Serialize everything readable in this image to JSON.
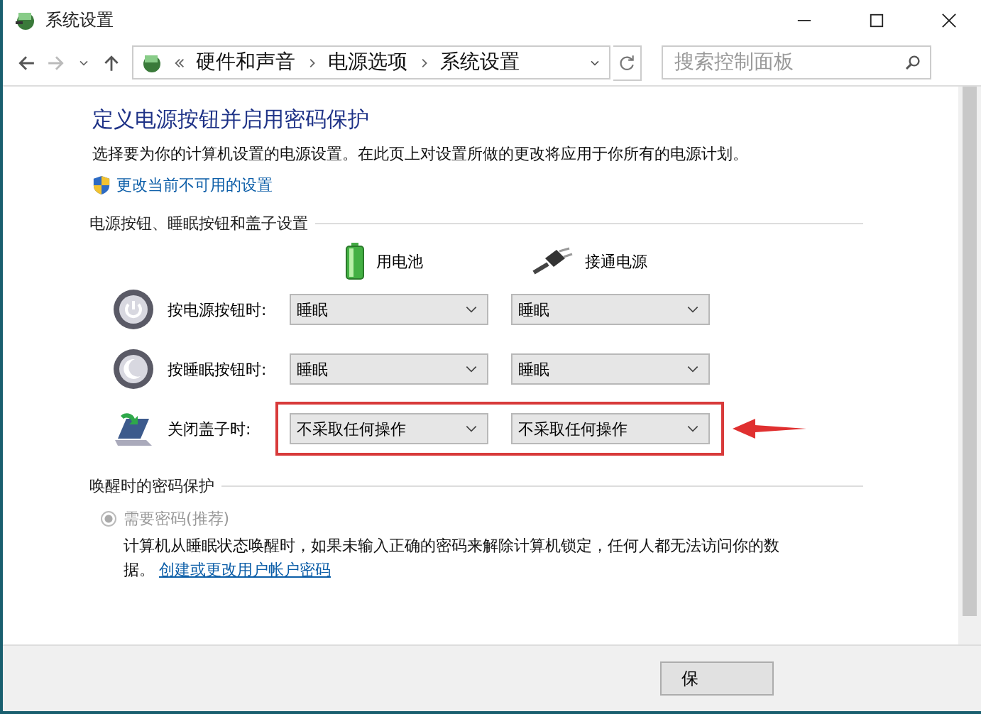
{
  "window": {
    "title": "系统设置"
  },
  "nav": {
    "breadcrumb": [
      "硬件和声音",
      "电源选项",
      "系统设置"
    ],
    "search": {
      "placeholder": "搜索控制面板"
    }
  },
  "page": {
    "heading": "定义电源按钮并启用密码保护",
    "description": "选择要为你的计算机设置的电源设置。在此页上对设置所做的更改将应用于你所有的电源计划。",
    "admin_link": "更改当前不可用的设置"
  },
  "power_section": {
    "title": "电源按钮、睡眠按钮和盖子设置",
    "columns": [
      {
        "kind": "battery",
        "label": "用电池"
      },
      {
        "kind": "plug",
        "label": "接通电源"
      }
    ],
    "rows": [
      {
        "kind": "power",
        "label": "按电源按钮时:",
        "values": [
          "睡眠",
          "睡眠"
        ],
        "highlighted": false
      },
      {
        "kind": "sleep",
        "label": "按睡眠按钮时:",
        "values": [
          "睡眠",
          "睡眠"
        ],
        "highlighted": false
      },
      {
        "kind": "lid",
        "label": "关闭盖子时:",
        "values": [
          "不采取任何操作",
          "不采取任何操作"
        ],
        "highlighted": true
      }
    ]
  },
  "wake_section": {
    "title": "唤醒时的密码保护",
    "options": [
      {
        "label": "需要密码(推荐)",
        "selected": true,
        "disabled": true,
        "description": "计算机从睡眠状态唤醒时，如果未输入正确的密码来解除计算机锁定，任何人都无法访问你的数据。",
        "link": "创建或更改用户帐户密码"
      }
    ]
  },
  "buttons": [
    "保"
  ]
}
